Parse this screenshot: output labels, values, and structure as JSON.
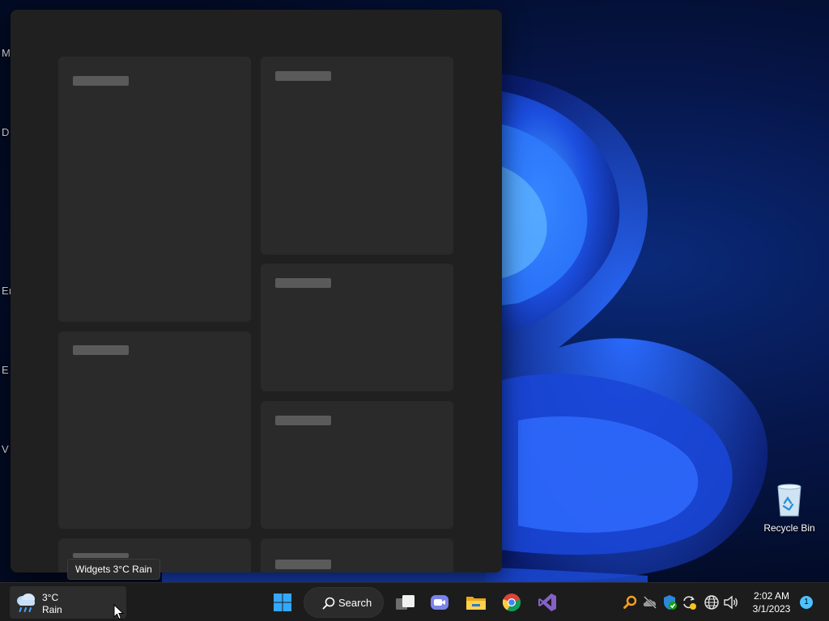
{
  "desktop": {
    "edge_letters": [
      "M",
      "D",
      "Eı",
      "E",
      "V"
    ],
    "recycle_bin": {
      "label": "Recycle Bin",
      "icon": "recycle-bin-icon"
    }
  },
  "widgets_panel": {
    "cards": [
      "placeholder",
      "placeholder",
      "placeholder",
      "placeholder",
      "placeholder",
      "placeholder",
      "placeholder",
      "placeholder"
    ]
  },
  "tooltip": {
    "text": "Widgets 3°C Rain"
  },
  "taskbar": {
    "weather": {
      "temp": "3°C",
      "condition": "Rain",
      "icon": "cloud-rain-icon"
    },
    "search": {
      "label": "Search",
      "icon": "search-icon"
    },
    "apps": [
      {
        "name": "start",
        "icon": "windows-logo-icon"
      },
      {
        "name": "task-view",
        "icon": "task-view-icon"
      },
      {
        "name": "teams-chat",
        "icon": "video-chat-icon"
      },
      {
        "name": "file-explorer",
        "icon": "folder-icon"
      },
      {
        "name": "chrome",
        "icon": "chrome-icon"
      },
      {
        "name": "visual-studio",
        "icon": "visual-studio-icon"
      }
    ],
    "tray": [
      "search-magnifier-icon",
      "onedrive-offline-icon",
      "defender-icon",
      "sync-icon",
      "network-icon",
      "volume-icon"
    ],
    "clock": {
      "time": "2:02 AM",
      "date": "3/1/2023"
    },
    "notifications": {
      "count": "1"
    }
  },
  "colors": {
    "accent": "#4cc2ff",
    "taskbar": "#1c1c1c",
    "panel": "#202020",
    "card": "#2a2a2a"
  }
}
